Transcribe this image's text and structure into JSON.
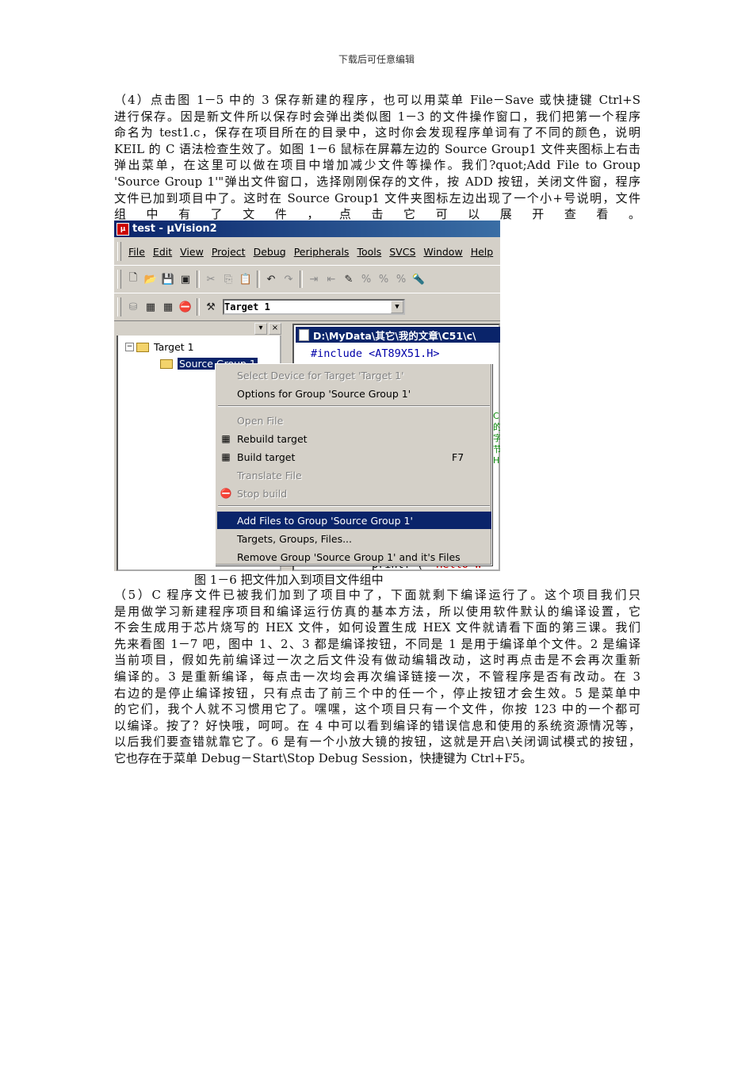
{
  "header_note": "下载后可任意编辑",
  "para4": [
    "（4）点击图 1－5 中的 3 保存新建的程序，也可以用菜单 File－Save 或快捷键 Ctrl+S",
    "进行保存。因是新文件所以保存时会弹出类似图 1－3 的文件操作窗口，我们把第一个程序",
    "命名为 test1.c，保存在项目所在的目录中，这时你会发现程序单词有了不同的颜色，说明",
    "KEIL 的 C 语法检查生效了。如图 1－6 鼠标在屏幕左边的 Source Group1 文件夹图标上右击",
    "弹出菜单，在这里可以做在项目中增加减少文件等操作。我们?quot;Add File to Group",
    "'Source Group 1'\"弹出文件窗口，选择刚刚保存的文件，按 ADD 按钮，关闭文件窗，程序",
    "文件已加到项目中了。这时在 Source Group1 文件夹图标左边出现了一个小+号说明，文件",
    "组 中 有 了 文 件 ， 点 击 它 可 以 展 开 查 看 。"
  ],
  "screenshot": {
    "window_title": "test - µVision2",
    "menu": [
      "File",
      "Edit",
      "View",
      "Project",
      "Debug",
      "Peripherals",
      "Tools",
      "SVCS",
      "Window",
      "Help"
    ],
    "target_select": "Target 1",
    "tree": {
      "root": "Target 1",
      "group": "Source Group 1"
    },
    "editor_title": "D:\\MyData\\其它\\我的文章\\C51\\c\\",
    "code_line": "#include <AT89X51.H>",
    "code_tail_fn": "printf (",
    "code_tail_str": "\"Hello W",
    "green_fragment": "C\n的\n字\n节\nH",
    "context_menu": {
      "items": [
        {
          "label": "Select Device for Target 'Target 1'",
          "disabled": true
        },
        {
          "label": "Options for Group 'Source Group 1'",
          "disabled": false
        },
        {
          "label": "Open File",
          "disabled": true
        },
        {
          "label": "Rebuild target",
          "disabled": false,
          "icon": "rebuild-icon"
        },
        {
          "label": "Build target",
          "disabled": false,
          "icon": "build-icon",
          "accel": "F7"
        },
        {
          "label": "Translate File",
          "disabled": true
        },
        {
          "label": "Stop build",
          "disabled": true,
          "icon": "stop-build-icon"
        },
        {
          "label": "Add Files to Group 'Source Group 1'",
          "disabled": false,
          "active": true
        },
        {
          "label": "Targets, Groups, Files...",
          "disabled": false
        },
        {
          "label": "Remove Group 'Source Group 1' and it's Files",
          "disabled": false
        }
      ]
    }
  },
  "caption": "图 1－6 把文件加入到项目文件组中",
  "para5": [
    "（5）C 程序文件已被我们加到了项目中了，下面就剩下编译运行了。这个项目我们只",
    "是用做学习新建程序项目和编译运行仿真的基本方法，所以使用软件默认的编译设置，它",
    "不会生成用于芯片烧写的 HEX 文件，如何设置生成 HEX 文件就请看下面的第三课。我们",
    "先来看图 1－7 吧，图中 1、2、3 都是编译按钮，不同是 1 是用于编译单个文件。2 是编译",
    "当前项目，假如先前编译过一次之后文件没有做动编辑改动，这时再点击是不会再次重新",
    "编译的。3 是重新编译，每点击一次均会再次编译链接一次，不管程序是否有改动。在 3",
    "右边的是停止编译按钮，只有点击了前三个中的任一个，停止按钮才会生效。5 是菜单中",
    "的它们，我个人就不习惯用它了。嘿嘿，这个项目只有一个文件，你按 123 中的一个都可",
    "以编译。按了？好快哦，呵呵。在 4 中可以看到编译的错误信息和使用的系统资源情况等，",
    "以后我们要查错就靠它了。6 是有一个小放大镜的按钮，这就是开启\\关闭调试模式的按钮，",
    "它也存在于菜单 Debug－Start\\Stop Debug Session，快捷键为 Ctrl+F5。"
  ]
}
